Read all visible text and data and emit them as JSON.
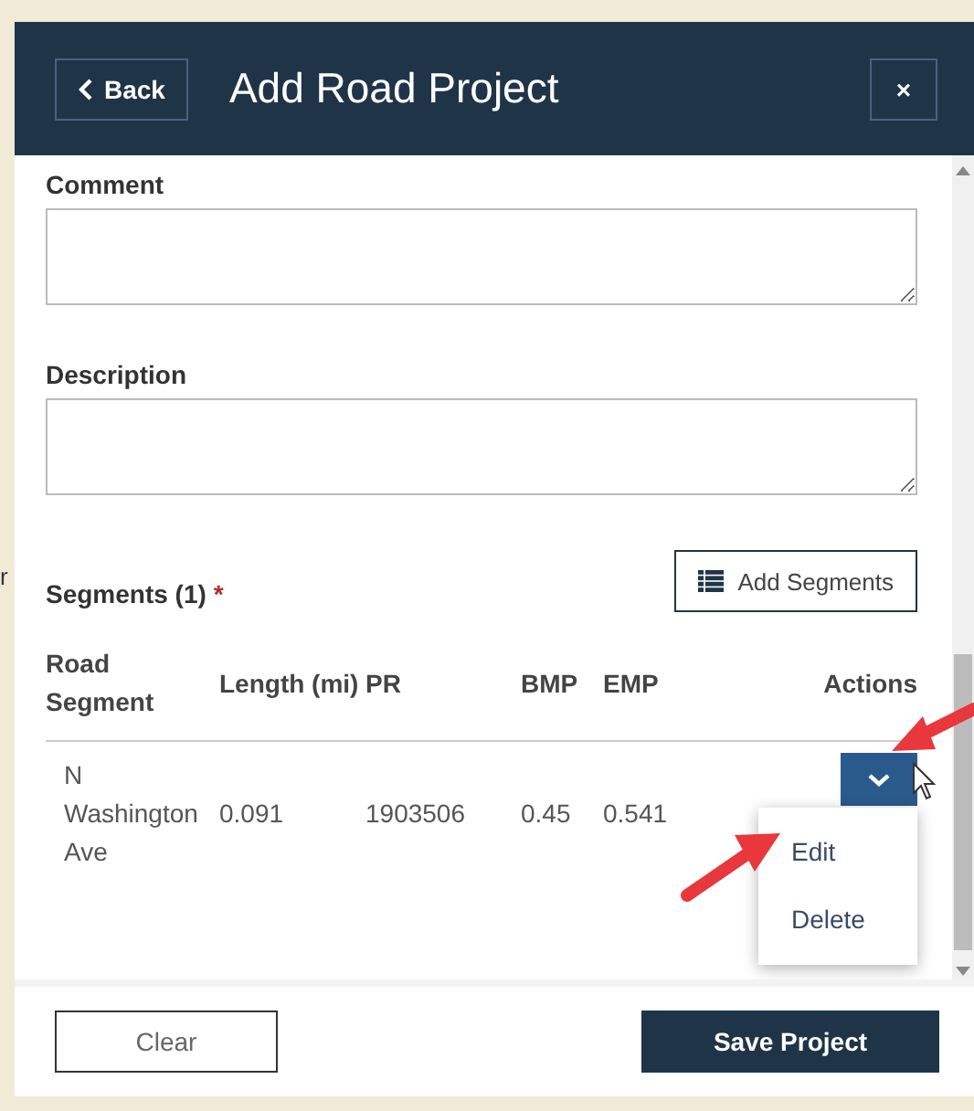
{
  "background_fragment": "r",
  "header": {
    "back_label": "Back",
    "title": "Add Road Project",
    "close_label": "×"
  },
  "fields": [
    {
      "label": "Comment"
    },
    {
      "label": "Description"
    }
  ],
  "segments": {
    "label": "Segments (1)",
    "required_mark": "*",
    "add_label": "Add Segments",
    "columns": [
      "Road Segment",
      "Length (mi)",
      "PR",
      "BMP",
      "EMP",
      "Actions"
    ],
    "rows": [
      {
        "cells": [
          "N Washington Ave",
          "0.091",
          "1903506",
          "0.45",
          "0.541"
        ],
        "menu_open": true,
        "menu": [
          "Edit",
          "Delete"
        ]
      }
    ]
  },
  "footer": {
    "clear_label": "Clear",
    "save_label": "Save Project"
  }
}
